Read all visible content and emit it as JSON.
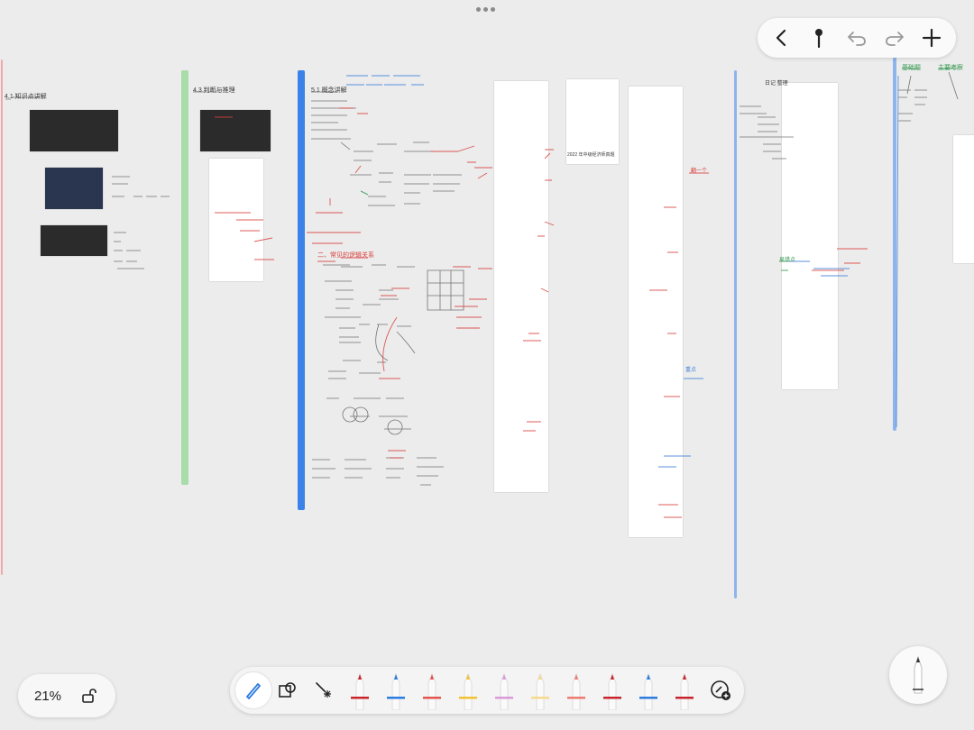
{
  "zoom": {
    "level": "21%"
  },
  "toolbar": {
    "back_icon": "chevron-left-icon",
    "pin_icon": "pin-icon",
    "undo_icon": "undo-icon",
    "redo_icon": "redo-icon",
    "add_icon": "plus-icon"
  },
  "tools": [
    {
      "name": "pen-tool",
      "icon": "pen-icon",
      "selected": true
    },
    {
      "name": "shapes-tool",
      "icon": "shapes-icon",
      "selected": false
    },
    {
      "name": "laser-tool",
      "icon": "laser-pointer-icon",
      "selected": false
    }
  ],
  "pens": [
    {
      "color": "#c8232a"
    },
    {
      "color": "#2b7be0"
    },
    {
      "color": "#e4534d"
    },
    {
      "color": "#f1c232"
    },
    {
      "color": "#d89ad8"
    },
    {
      "color": "#f6d98a"
    },
    {
      "color": "#ee7a70"
    },
    {
      "color": "#c8232a"
    },
    {
      "color": "#2b7be0"
    },
    {
      "color": "#c8232a"
    }
  ],
  "canvas": {
    "notes": [
      {
        "text": "4.1 知识点讲解",
        "color": "k"
      },
      {
        "text": "4.3 判断与推理",
        "color": "k"
      },
      {
        "text": "5.1 概念讲解",
        "color": "k"
      },
      {
        "text": "二、常见的逻辑关系",
        "color": "r"
      },
      {
        "text": "2022 年中级经济师真题",
        "color": "k"
      },
      {
        "text": "日记 整理",
        "color": "k"
      },
      {
        "text": "翻一个",
        "color": "r"
      },
      {
        "text": "易错点",
        "color": "g"
      },
      {
        "text": "重点",
        "color": "b"
      },
      {
        "text": "基础题",
        "color": "g"
      },
      {
        "text": "主要考察",
        "color": "g"
      }
    ]
  }
}
